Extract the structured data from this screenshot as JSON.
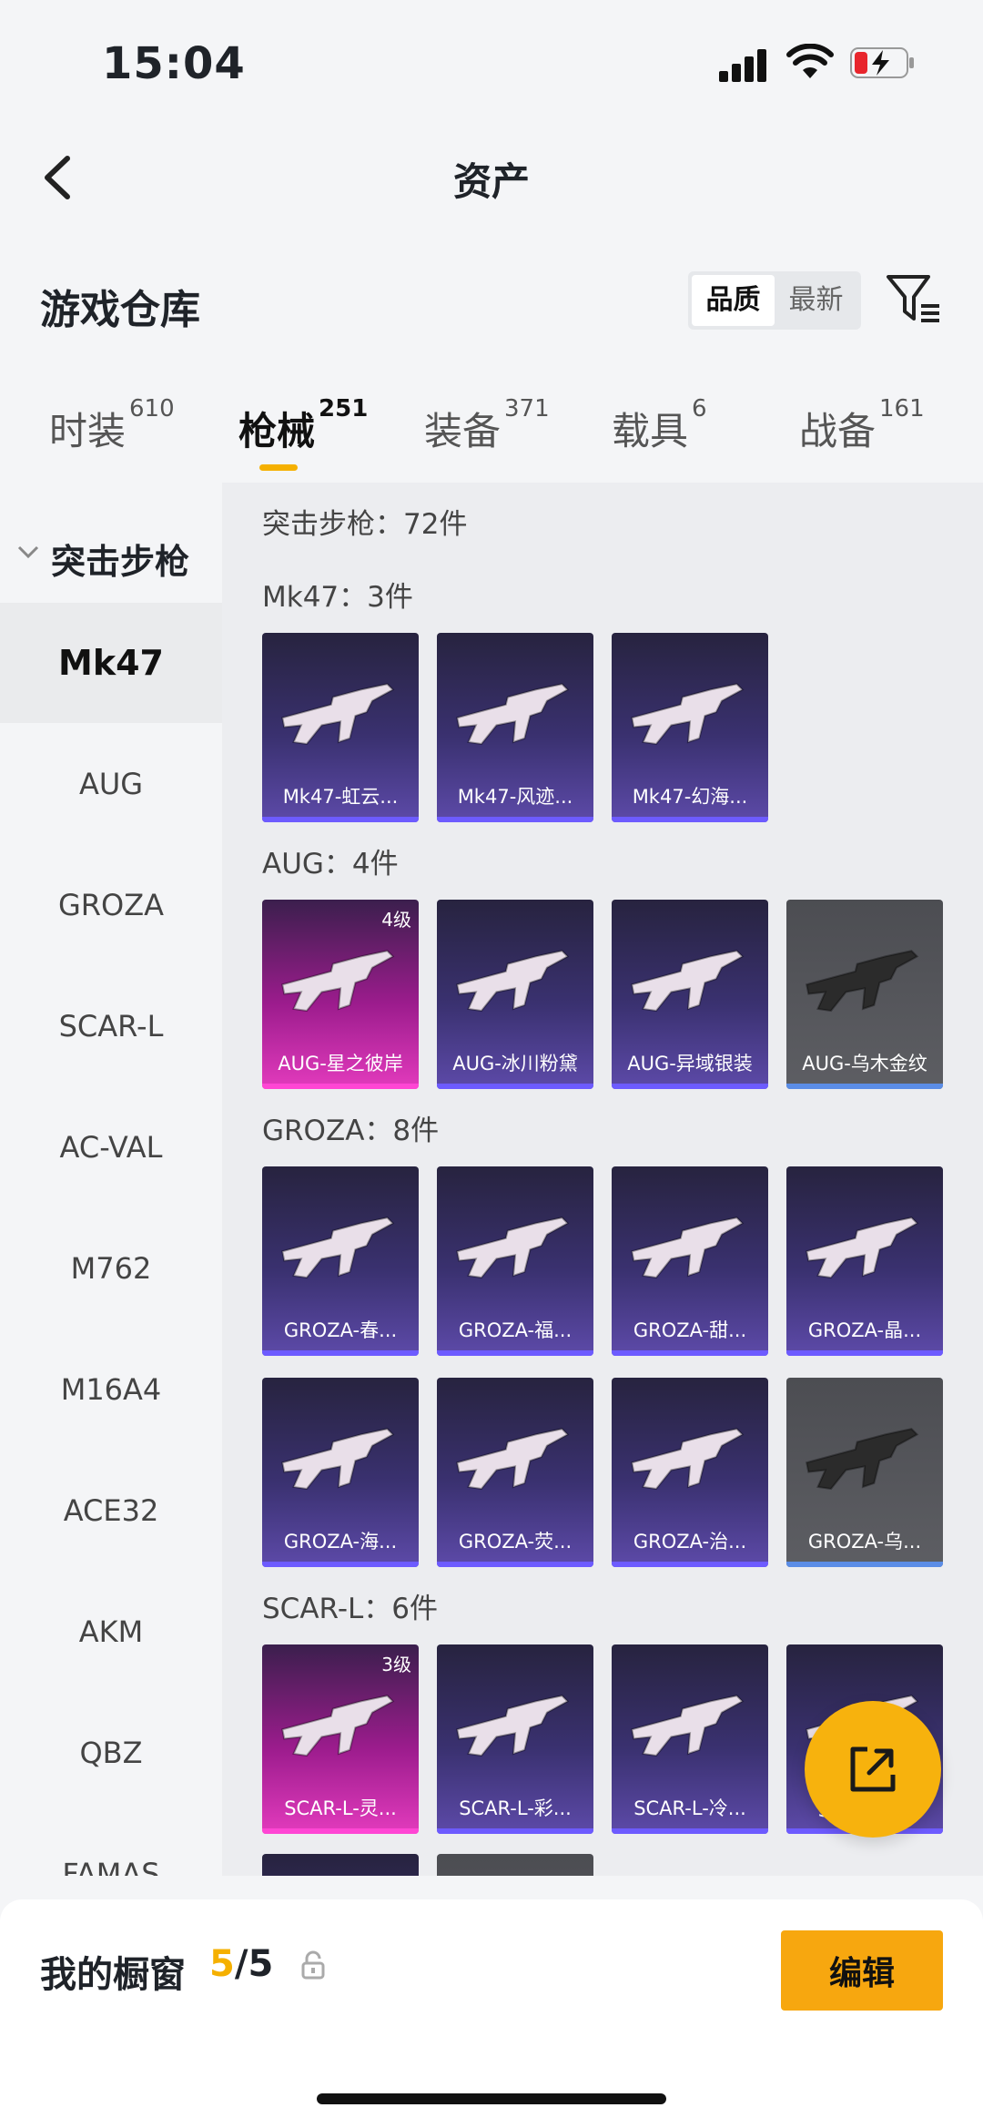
{
  "status": {
    "time": "15:04"
  },
  "header": {
    "title": "资产"
  },
  "warehouse": {
    "title": "游戏仓库",
    "sort_options": [
      "品质",
      "最新"
    ],
    "sort_active": "品质"
  },
  "tabs": [
    {
      "label": "时装",
      "count": "610"
    },
    {
      "label": "枪械",
      "count": "251"
    },
    {
      "label": "装备",
      "count": "371"
    },
    {
      "label": "载具",
      "count": "6"
    },
    {
      "label": "战备",
      "count": "161"
    }
  ],
  "sidebar": {
    "group": "突击步枪",
    "items": [
      "Mk47",
      "AUG",
      "GROZA",
      "SCAR-L",
      "AC-VAL",
      "M762",
      "M16A4",
      "ACE32",
      "AKM",
      "QBZ",
      "FAMAS"
    ],
    "active": "Mk47"
  },
  "main": {
    "total": "突击步枪：72件",
    "sections": [
      {
        "head": "Mk47：3件",
        "cards": [
          {
            "name": "Mk47-虹云...",
            "style": "purple",
            "level": ""
          },
          {
            "name": "Mk47-风迹...",
            "style": "purple",
            "level": ""
          },
          {
            "name": "Mk47-幻海...",
            "style": "purple",
            "level": ""
          }
        ]
      },
      {
        "head": "AUG：4件",
        "cards": [
          {
            "name": "AUG-星之彼岸",
            "style": "pink",
            "level": "4级"
          },
          {
            "name": "AUG-冰川粉黛",
            "style": "purple",
            "level": ""
          },
          {
            "name": "AUG-异域银装",
            "style": "purple",
            "level": ""
          },
          {
            "name": "AUG-乌木金纹",
            "style": "grey",
            "level": ""
          }
        ]
      },
      {
        "head": "GROZA：8件",
        "cards": [
          {
            "name": "GROZA-春...",
            "style": "purple",
            "level": ""
          },
          {
            "name": "GROZA-福...",
            "style": "purple",
            "level": ""
          },
          {
            "name": "GROZA-甜...",
            "style": "purple",
            "level": ""
          },
          {
            "name": "GROZA-晶...",
            "style": "purple",
            "level": ""
          },
          {
            "name": "GROZA-海...",
            "style": "purple",
            "level": ""
          },
          {
            "name": "GROZA-荧...",
            "style": "purple",
            "level": ""
          },
          {
            "name": "GROZA-治...",
            "style": "purple",
            "level": ""
          },
          {
            "name": "GROZA-乌...",
            "style": "grey",
            "level": ""
          }
        ]
      },
      {
        "head": "SCAR-L：6件",
        "cards": [
          {
            "name": "SCAR-L-灵...",
            "style": "pink",
            "level": "3级"
          },
          {
            "name": "SCAR-L-彩...",
            "style": "purple",
            "level": ""
          },
          {
            "name": "SCAR-L-冷...",
            "style": "purple",
            "level": ""
          },
          {
            "name": "SCAR-L-...",
            "style": "purple",
            "level": ""
          }
        ]
      }
    ]
  },
  "showcase": {
    "label": "我的橱窗",
    "current": "5",
    "total": "/5",
    "edit": "编辑"
  },
  "colors": {
    "accent": "#f5b000",
    "purple_card": "#3a3170",
    "pink_card": "#9c1c8d",
    "grey_card": "#5d5e63"
  }
}
